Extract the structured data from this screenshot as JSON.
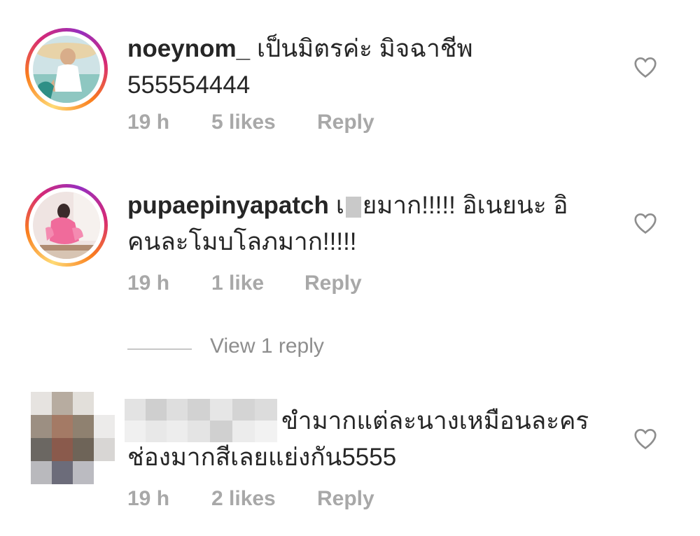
{
  "comments": [
    {
      "username": "noeynom_",
      "text_line1": "เป็นมิตรค่ะ มิจฉาชีพ",
      "text_line2": "555554444",
      "time": "19 h",
      "likes": "5 likes",
      "reply_label": "Reply",
      "heart_icon": "heart-outline-icon"
    },
    {
      "username": "pupaepinyapatch",
      "text_line1_a": "เ",
      "text_line1_b": "ยมาก!!!!! อิเนยนะ อิ",
      "text_line2": "คนละโมบโลภมาก!!!!!",
      "time": "19 h",
      "likes": "1 like",
      "reply_label": "Reply",
      "heart_icon": "heart-outline-icon"
    },
    {
      "username": "",
      "text_line1": "ขำมากแต่ละนางเหมือนละคร",
      "text_line2": "ช่องมากสีเลยแย่งกัน5555",
      "time": "19 h",
      "likes": "2 likes",
      "reply_label": "Reply",
      "heart_icon": "heart-outline-icon"
    }
  ],
  "view_replies": "View 1 reply",
  "colors": {
    "text": "#262626",
    "meta": "#a8a8a8",
    "heart": "#8e8e8e"
  }
}
